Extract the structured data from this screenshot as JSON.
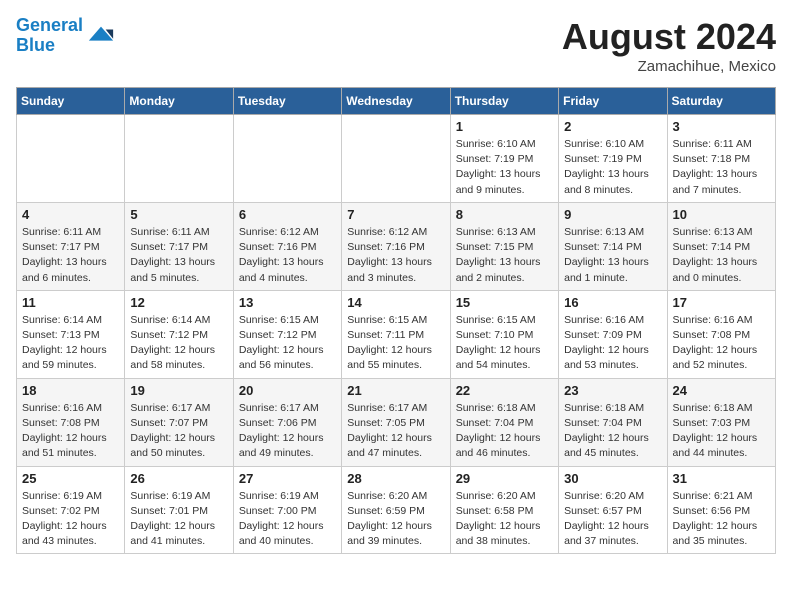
{
  "header": {
    "logo_line1": "General",
    "logo_line2": "Blue",
    "main_title": "August 2024",
    "subtitle": "Zamachihue, Mexico"
  },
  "days_of_week": [
    "Sunday",
    "Monday",
    "Tuesday",
    "Wednesday",
    "Thursday",
    "Friday",
    "Saturday"
  ],
  "weeks": [
    [
      {
        "day": "",
        "info": ""
      },
      {
        "day": "",
        "info": ""
      },
      {
        "day": "",
        "info": ""
      },
      {
        "day": "",
        "info": ""
      },
      {
        "day": "1",
        "info": "Sunrise: 6:10 AM\nSunset: 7:19 PM\nDaylight: 13 hours\nand 9 minutes."
      },
      {
        "day": "2",
        "info": "Sunrise: 6:10 AM\nSunset: 7:19 PM\nDaylight: 13 hours\nand 8 minutes."
      },
      {
        "day": "3",
        "info": "Sunrise: 6:11 AM\nSunset: 7:18 PM\nDaylight: 13 hours\nand 7 minutes."
      }
    ],
    [
      {
        "day": "4",
        "info": "Sunrise: 6:11 AM\nSunset: 7:17 PM\nDaylight: 13 hours\nand 6 minutes."
      },
      {
        "day": "5",
        "info": "Sunrise: 6:11 AM\nSunset: 7:17 PM\nDaylight: 13 hours\nand 5 minutes."
      },
      {
        "day": "6",
        "info": "Sunrise: 6:12 AM\nSunset: 7:16 PM\nDaylight: 13 hours\nand 4 minutes."
      },
      {
        "day": "7",
        "info": "Sunrise: 6:12 AM\nSunset: 7:16 PM\nDaylight: 13 hours\nand 3 minutes."
      },
      {
        "day": "8",
        "info": "Sunrise: 6:13 AM\nSunset: 7:15 PM\nDaylight: 13 hours\nand 2 minutes."
      },
      {
        "day": "9",
        "info": "Sunrise: 6:13 AM\nSunset: 7:14 PM\nDaylight: 13 hours\nand 1 minute."
      },
      {
        "day": "10",
        "info": "Sunrise: 6:13 AM\nSunset: 7:14 PM\nDaylight: 13 hours\nand 0 minutes."
      }
    ],
    [
      {
        "day": "11",
        "info": "Sunrise: 6:14 AM\nSunset: 7:13 PM\nDaylight: 12 hours\nand 59 minutes."
      },
      {
        "day": "12",
        "info": "Sunrise: 6:14 AM\nSunset: 7:12 PM\nDaylight: 12 hours\nand 58 minutes."
      },
      {
        "day": "13",
        "info": "Sunrise: 6:15 AM\nSunset: 7:12 PM\nDaylight: 12 hours\nand 56 minutes."
      },
      {
        "day": "14",
        "info": "Sunrise: 6:15 AM\nSunset: 7:11 PM\nDaylight: 12 hours\nand 55 minutes."
      },
      {
        "day": "15",
        "info": "Sunrise: 6:15 AM\nSunset: 7:10 PM\nDaylight: 12 hours\nand 54 minutes."
      },
      {
        "day": "16",
        "info": "Sunrise: 6:16 AM\nSunset: 7:09 PM\nDaylight: 12 hours\nand 53 minutes."
      },
      {
        "day": "17",
        "info": "Sunrise: 6:16 AM\nSunset: 7:08 PM\nDaylight: 12 hours\nand 52 minutes."
      }
    ],
    [
      {
        "day": "18",
        "info": "Sunrise: 6:16 AM\nSunset: 7:08 PM\nDaylight: 12 hours\nand 51 minutes."
      },
      {
        "day": "19",
        "info": "Sunrise: 6:17 AM\nSunset: 7:07 PM\nDaylight: 12 hours\nand 50 minutes."
      },
      {
        "day": "20",
        "info": "Sunrise: 6:17 AM\nSunset: 7:06 PM\nDaylight: 12 hours\nand 49 minutes."
      },
      {
        "day": "21",
        "info": "Sunrise: 6:17 AM\nSunset: 7:05 PM\nDaylight: 12 hours\nand 47 minutes."
      },
      {
        "day": "22",
        "info": "Sunrise: 6:18 AM\nSunset: 7:04 PM\nDaylight: 12 hours\nand 46 minutes."
      },
      {
        "day": "23",
        "info": "Sunrise: 6:18 AM\nSunset: 7:04 PM\nDaylight: 12 hours\nand 45 minutes."
      },
      {
        "day": "24",
        "info": "Sunrise: 6:18 AM\nSunset: 7:03 PM\nDaylight: 12 hours\nand 44 minutes."
      }
    ],
    [
      {
        "day": "25",
        "info": "Sunrise: 6:19 AM\nSunset: 7:02 PM\nDaylight: 12 hours\nand 43 minutes."
      },
      {
        "day": "26",
        "info": "Sunrise: 6:19 AM\nSunset: 7:01 PM\nDaylight: 12 hours\nand 41 minutes."
      },
      {
        "day": "27",
        "info": "Sunrise: 6:19 AM\nSunset: 7:00 PM\nDaylight: 12 hours\nand 40 minutes."
      },
      {
        "day": "28",
        "info": "Sunrise: 6:20 AM\nSunset: 6:59 PM\nDaylight: 12 hours\nand 39 minutes."
      },
      {
        "day": "29",
        "info": "Sunrise: 6:20 AM\nSunset: 6:58 PM\nDaylight: 12 hours\nand 38 minutes."
      },
      {
        "day": "30",
        "info": "Sunrise: 6:20 AM\nSunset: 6:57 PM\nDaylight: 12 hours\nand 37 minutes."
      },
      {
        "day": "31",
        "info": "Sunrise: 6:21 AM\nSunset: 6:56 PM\nDaylight: 12 hours\nand 35 minutes."
      }
    ]
  ]
}
